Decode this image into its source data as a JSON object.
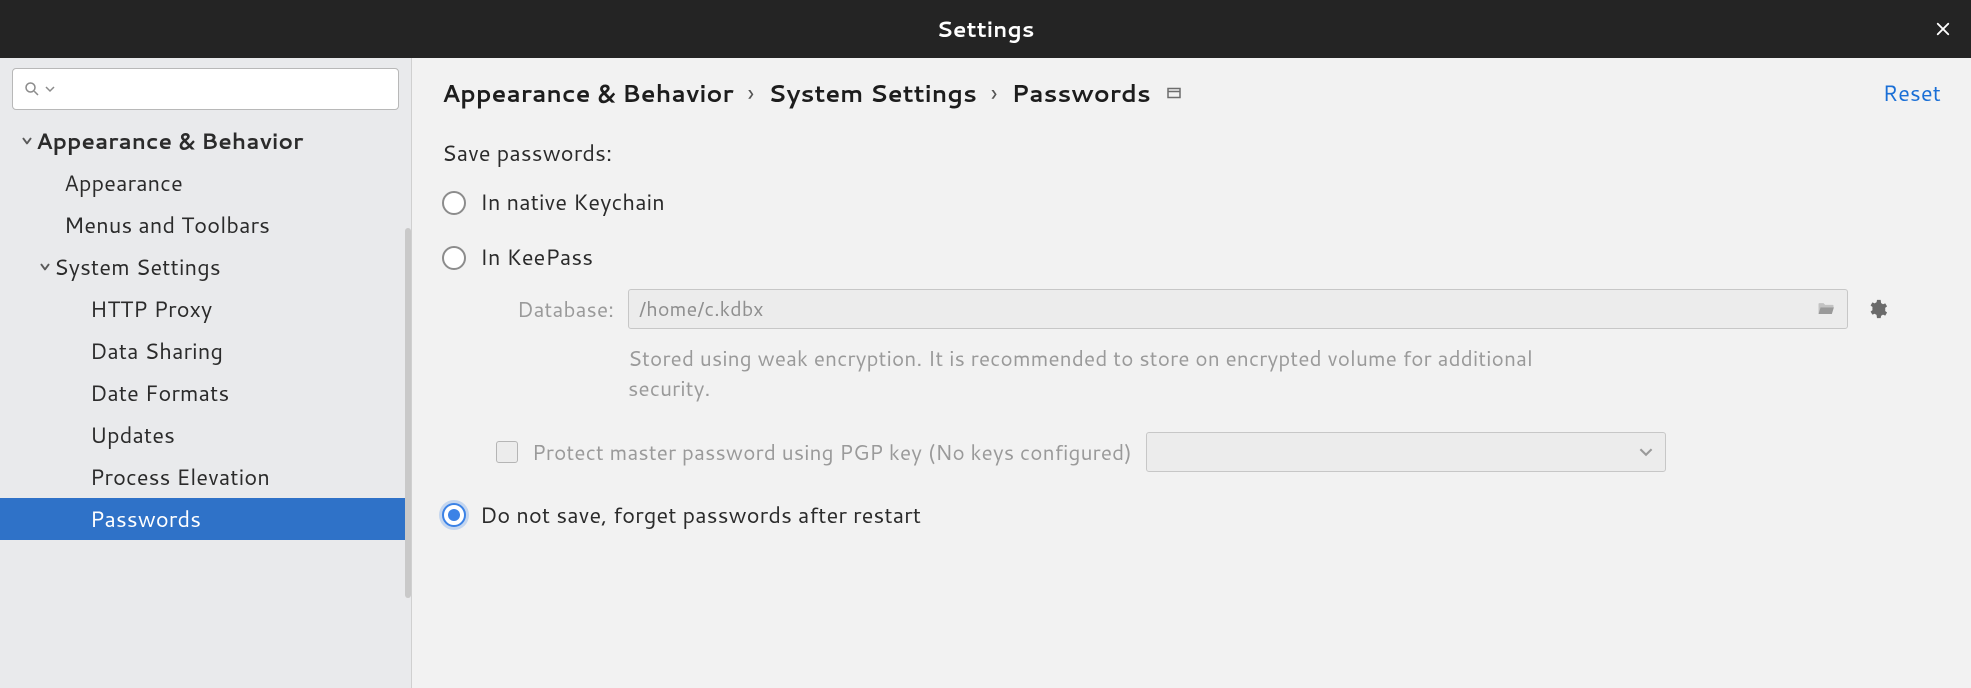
{
  "window": {
    "title": "Settings"
  },
  "sidebar": {
    "search_placeholder": "",
    "items": [
      {
        "label": "Appearance & Behavior",
        "level": 0,
        "expanded": true
      },
      {
        "label": "Appearance",
        "level": 1
      },
      {
        "label": "Menus and Toolbars",
        "level": 1
      },
      {
        "label": "System Settings",
        "level": 1,
        "expanded": true,
        "haschild": true
      },
      {
        "label": "HTTP Proxy",
        "level": 2
      },
      {
        "label": "Data Sharing",
        "level": 2
      },
      {
        "label": "Date Formats",
        "level": 2
      },
      {
        "label": "Updates",
        "level": 2
      },
      {
        "label": "Process Elevation",
        "level": 2
      },
      {
        "label": "Passwords",
        "level": 2,
        "selected": true
      }
    ]
  },
  "breadcrumb": {
    "parts": [
      "Appearance & Behavior",
      "System Settings",
      "Passwords"
    ],
    "reset_label": "Reset"
  },
  "content": {
    "section_label": "Save passwords:",
    "option_native": "In native Keychain",
    "option_keepass": "In KeePass",
    "database_label": "Database:",
    "database_value": "/home/c.kdbx",
    "encryption_hint": "Stored using weak encryption. It is recommended to store on encrypted volume for additional security.",
    "pgp_label": "Protect master password using PGP key (No keys configured)",
    "option_donotsave": "Do not save, forget passwords after restart",
    "selected_option": "donotsave"
  }
}
